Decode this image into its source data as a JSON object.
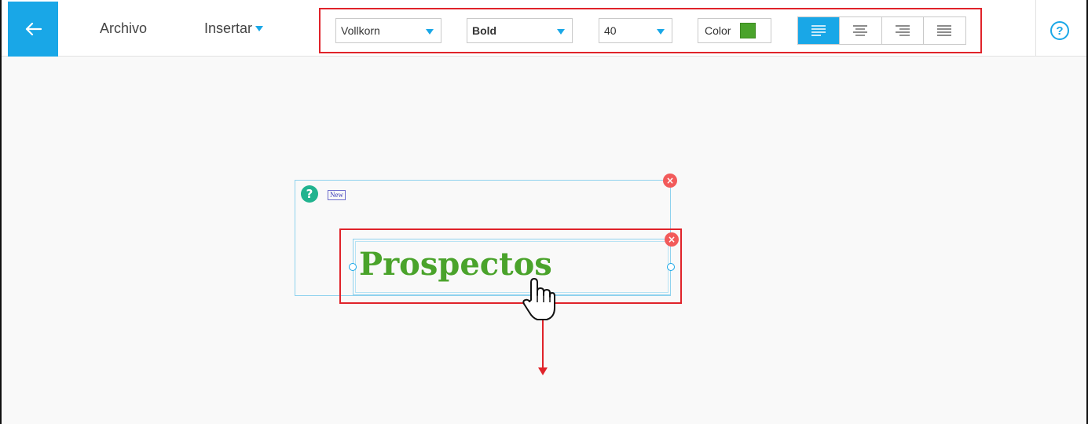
{
  "header": {
    "menu_archivo": "Archivo",
    "menu_insertar": "Insertar"
  },
  "toolbar": {
    "font_family": "Vollkorn",
    "font_weight": "Bold",
    "font_size": "40",
    "color_label": "Color",
    "color_value": "#4aa32b",
    "alignment_options": [
      "align-left",
      "align-center",
      "align-right",
      "justify"
    ],
    "active_alignment": "align-left"
  },
  "canvas": {
    "badge_label": "New",
    "text_content": "Prospectos",
    "text_color": "#4aa32b"
  },
  "icons": {
    "back": "arrow-left-icon",
    "help": "help-circle-icon",
    "question": "question-icon",
    "close": "close-icon",
    "cursor": "hand-pointer-icon"
  },
  "colors": {
    "accent": "#19a7e7",
    "highlight": "#e0232a",
    "teal": "#21b38f",
    "close": "#f25b5b"
  }
}
